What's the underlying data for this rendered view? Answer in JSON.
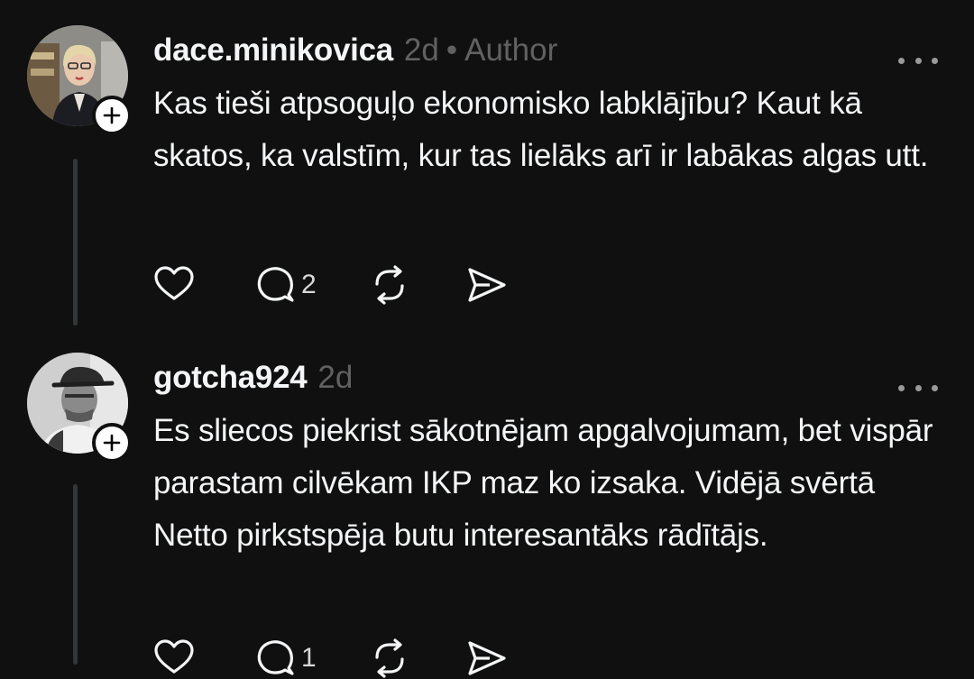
{
  "posts": [
    {
      "username": "dace.minikovica",
      "time": "2d",
      "separator": "•",
      "author_tag": "Author",
      "text": "Kas tieši atpsoguļo ekonomisko labklājību? Kaut kā skatos, ka valstīm, kur tas lielāks arī ir labākas algas utt.",
      "reply_count": "2",
      "icons": [
        "heart-icon",
        "comment-icon",
        "repost-icon",
        "share-icon",
        "more-icon"
      ]
    },
    {
      "username": "gotcha924",
      "time": "2d",
      "text": "Es sliecos piekrist sākotnējam apgalvojumam, bet vispār parastam cilvēkam IKP maz ko izsaka. Vidējā svērtā Netto pirkstspēja butu interesantāks rādītājs.",
      "reply_count": "1",
      "icons": [
        "heart-icon",
        "comment-icon",
        "repost-icon",
        "share-icon",
        "more-icon"
      ]
    }
  ],
  "colors": {
    "background": "#101010",
    "text": "#f3f5f7",
    "muted": "#616161",
    "thread_line": "#333638"
  }
}
